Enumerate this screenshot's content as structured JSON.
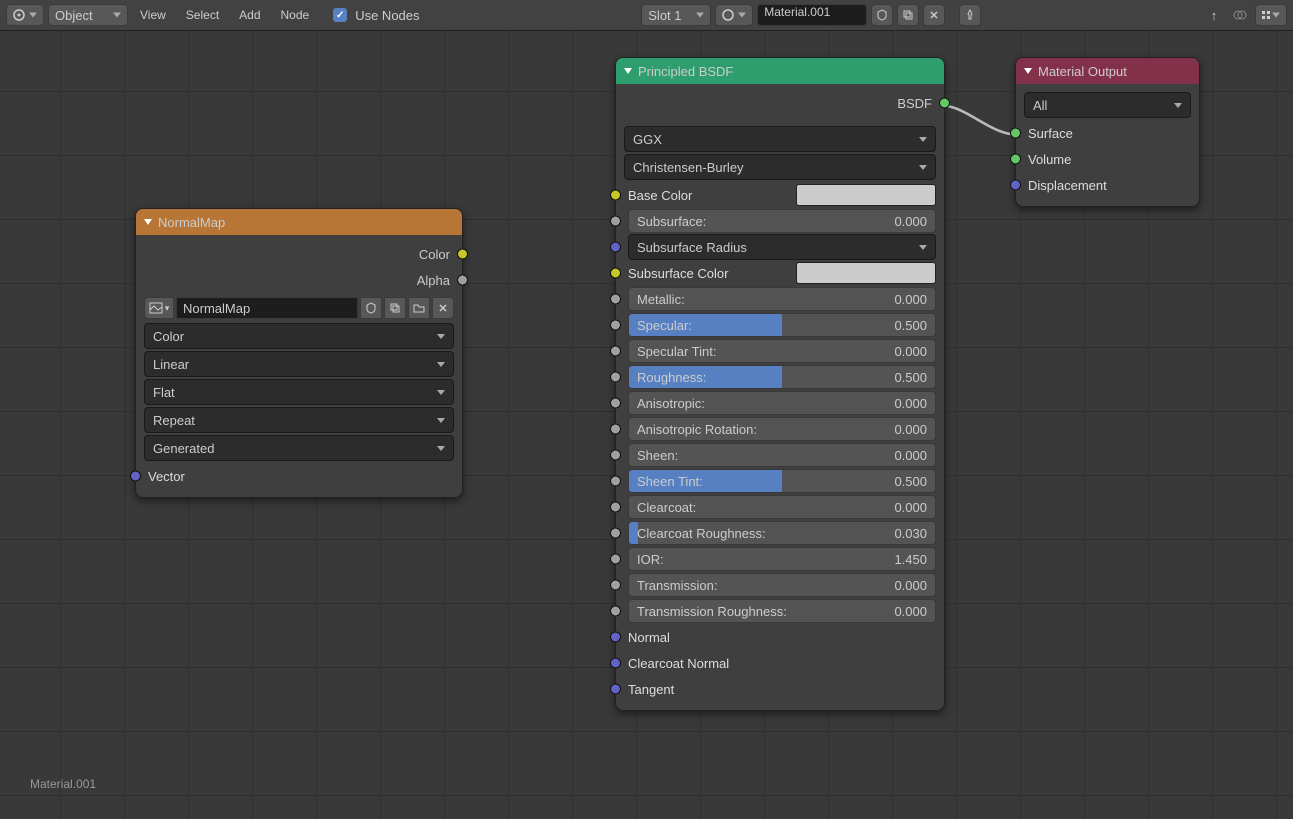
{
  "topbar": {
    "snap_mode": "",
    "object_mode": "Object",
    "menu": {
      "view": "View",
      "select": "Select",
      "add": "Add",
      "node": "Node"
    },
    "use_nodes_label": "Use Nodes",
    "slot": "Slot 1",
    "material_name": "Material.001"
  },
  "breadcrumb": "Material.001",
  "normalmap": {
    "title": "NormalMap",
    "out_color": "Color",
    "out_alpha": "Alpha",
    "image_name": "NormalMap",
    "dd_color": "Color",
    "dd_interp": "Linear",
    "dd_proj": "Flat",
    "dd_ext": "Repeat",
    "dd_coord": "Generated",
    "in_vector": "Vector"
  },
  "bsdf": {
    "title": "Principled BSDF",
    "out_bsdf": "BSDF",
    "dist": "GGX",
    "sss_method": "Christensen-Burley",
    "base_color": "Base Color",
    "subsurface": {
      "label": "Subsurface:",
      "val": "0.000",
      "fill": 0
    },
    "subsurface_radius": "Subsurface Radius",
    "subsurface_color": "Subsurface Color",
    "metallic": {
      "label": "Metallic:",
      "val": "0.000",
      "fill": 0
    },
    "specular": {
      "label": "Specular:",
      "val": "0.500",
      "fill": 50
    },
    "specular_tint": {
      "label": "Specular Tint:",
      "val": "0.000",
      "fill": 0
    },
    "roughness": {
      "label": "Roughness:",
      "val": "0.500",
      "fill": 50
    },
    "anisotropic": {
      "label": "Anisotropic:",
      "val": "0.000",
      "fill": 0
    },
    "anisotropic_rot": {
      "label": "Anisotropic Rotation:",
      "val": "0.000",
      "fill": 0
    },
    "sheen": {
      "label": "Sheen:",
      "val": "0.000",
      "fill": 0
    },
    "sheen_tint": {
      "label": "Sheen Tint:",
      "val": "0.500",
      "fill": 50
    },
    "clearcoat": {
      "label": "Clearcoat:",
      "val": "0.000",
      "fill": 0
    },
    "clearcoat_rough": {
      "label": "Clearcoat Roughness:",
      "val": "0.030",
      "fill": 3
    },
    "ior": {
      "label": "IOR:",
      "val": "1.450",
      "fill": 0
    },
    "transmission": {
      "label": "Transmission:",
      "val": "0.000",
      "fill": 0
    },
    "transmission_rough": {
      "label": "Transmission Roughness:",
      "val": "0.000",
      "fill": 0
    },
    "in_normal": "Normal",
    "in_clearcoat_normal": "Clearcoat Normal",
    "in_tangent": "Tangent"
  },
  "output": {
    "title": "Material Output",
    "target": "All",
    "surface": "Surface",
    "volume": "Volume",
    "displacement": "Displacement"
  }
}
